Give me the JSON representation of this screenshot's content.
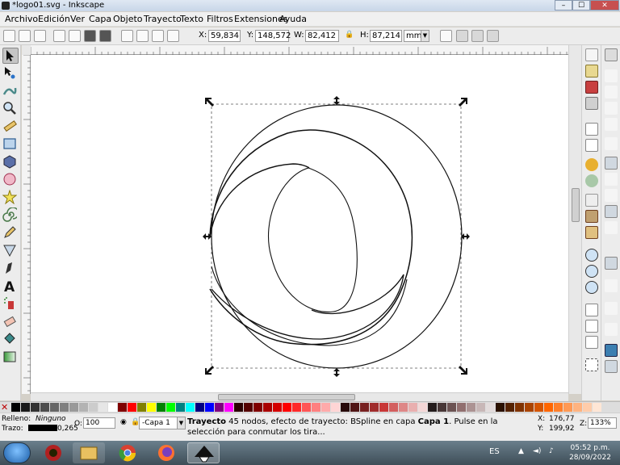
{
  "window": {
    "title": "*logo01.svg - Inkscape",
    "minimize": "–",
    "maximize": "☐",
    "close": "✕"
  },
  "menu": [
    "Archivo",
    "Edición",
    "Ver",
    "Capa",
    "Objeto",
    "Trayecto",
    "Texto",
    "Filtros",
    "Extensiones",
    "Ayuda"
  ],
  "toolbar": {
    "x_label": "X:",
    "x_value": "59,834",
    "y_label": "Y:",
    "y_value": "148,572",
    "w_label": "W:",
    "w_value": "82,412",
    "h_label": "H:",
    "h_value": "87,214",
    "unit": "mm"
  },
  "tools": [
    "selector-icon",
    "node-editor-icon",
    "tweak-icon",
    "zoom-icon",
    "measure-icon",
    "rectangle-icon",
    "3d-box-icon",
    "ellipse-icon",
    "star-icon",
    "spiral-icon",
    "pencil-icon",
    "pen-icon",
    "calligraphy-icon",
    "text-icon",
    "spray-icon",
    "eraser-icon",
    "paint-bucket-icon",
    "gradient-icon"
  ],
  "status": {
    "fill_label": "Relleno:",
    "fill_value": "Ninguno",
    "stroke_label": "Trazo:",
    "stroke_width": "0,265",
    "opacity_label": "O:",
    "opacity_value": "100",
    "layer": "-Capa 1",
    "message_bold": "Trayecto",
    "message_mid": " 45 nodos, efecto de trayecto: BSpline en capa ",
    "message_layer": "Capa 1",
    "message_end": ". Pulse en la selección para conmutar los tira...",
    "cursor_x_label": "X:",
    "cursor_x": "176,77",
    "cursor_y_label": "Y:",
    "cursor_y": "199,92",
    "zoom_label": "Z:",
    "zoom_value": "133%"
  },
  "taskbar": {
    "lang": "ES",
    "time": "05:52 p.m.",
    "date": "28/09/2022"
  },
  "colors": {
    "accent": "#3c7fb1",
    "palette": [
      "#000000",
      "#1a1a1a",
      "#333333",
      "#4d4d4d",
      "#666666",
      "#808080",
      "#999999",
      "#b3b3b3",
      "#cccccc",
      "#e6e6e6",
      "#ffffff",
      "#800000",
      "#ff0000",
      "#808000",
      "#ffff00",
      "#008000",
      "#00ff00",
      "#008080",
      "#00ffff",
      "#000080",
      "#0000ff",
      "#800080",
      "#ff00ff",
      "#2b0000",
      "#550000",
      "#800000",
      "#aa0000",
      "#d40000",
      "#ff0000",
      "#ff2a2a",
      "#ff5555",
      "#ff8080",
      "#ffaaaa",
      "#ffd5d5",
      "#280b0b",
      "#501616",
      "#782121",
      "#a02c2c",
      "#c83737",
      "#d35f5f",
      "#de8787",
      "#e9afaf",
      "#f4d7d7",
      "#241c1c",
      "#483737",
      "#6c5353",
      "#916f6f",
      "#ac9393",
      "#c8b7b7",
      "#e3dbdb",
      "#2b1100",
      "#552200",
      "#803300",
      "#aa4400",
      "#d45500",
      "#ff6600",
      "#ff7f2a",
      "#ff9955",
      "#ffb380",
      "#ffccaa",
      "#ffe6d5"
    ]
  }
}
